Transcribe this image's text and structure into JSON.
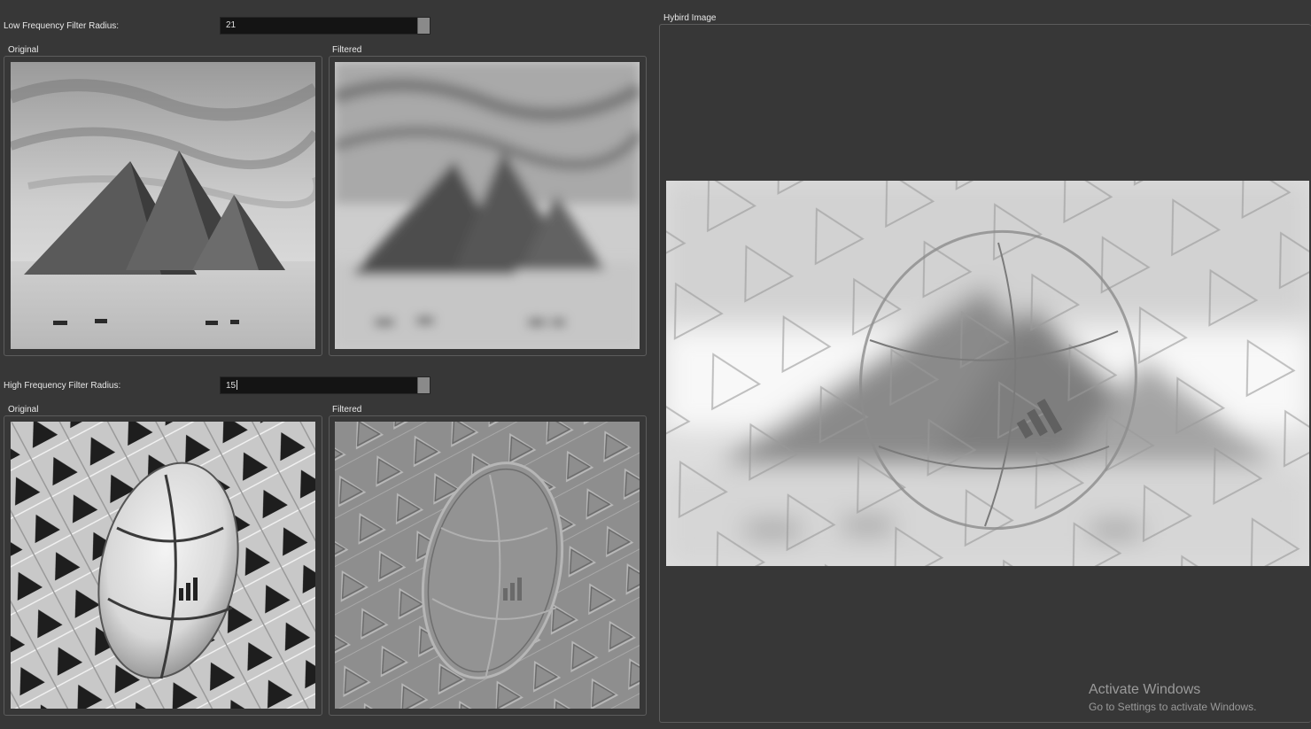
{
  "low_freq": {
    "label": "Low Frequency Filter Radius:",
    "value": "21",
    "original_title": "Original",
    "filtered_title": "Filtered"
  },
  "high_freq": {
    "label": "High Frequency Filter Radius:",
    "value": "15",
    "original_title": "Original",
    "filtered_title": "Filtered"
  },
  "hybrid": {
    "title": "Hybird Image"
  },
  "watermark": {
    "line1": "Activate Windows",
    "line2": "Go to Settings to activate Windows."
  }
}
